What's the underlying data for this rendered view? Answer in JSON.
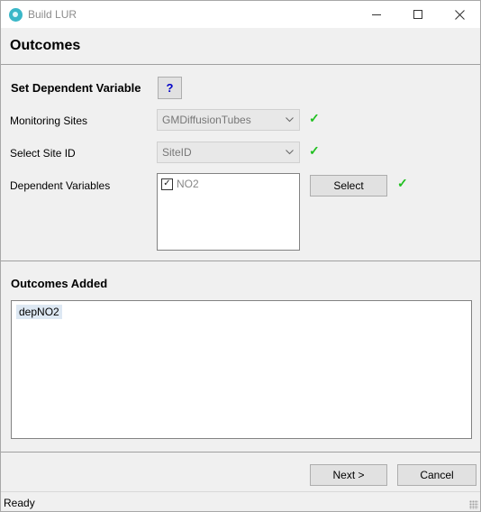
{
  "window": {
    "title": "Build LUR"
  },
  "header": {
    "title": "Outcomes"
  },
  "dependent_section": {
    "title": "Set Dependent Variable",
    "help_label": "?",
    "monitoring_sites": {
      "label": "Monitoring Sites",
      "value": "GMDiffusionTubes"
    },
    "site_id": {
      "label": "Select Site ID",
      "value": "SiteID"
    },
    "dependent_variables": {
      "label": "Dependent Variables",
      "items": [
        {
          "label": "NO2",
          "checked": true
        }
      ],
      "select_label": "Select"
    },
    "check_glyph": "✓"
  },
  "outcomes_section": {
    "title": "Outcomes Added",
    "items": [
      "depNO2"
    ]
  },
  "footer": {
    "next_label": "Next >",
    "cancel_label": "Cancel"
  },
  "status": {
    "text": "Ready"
  },
  "colors": {
    "check": "#20c020",
    "help_text": "#0000c8",
    "selection": "#dde8f3"
  }
}
